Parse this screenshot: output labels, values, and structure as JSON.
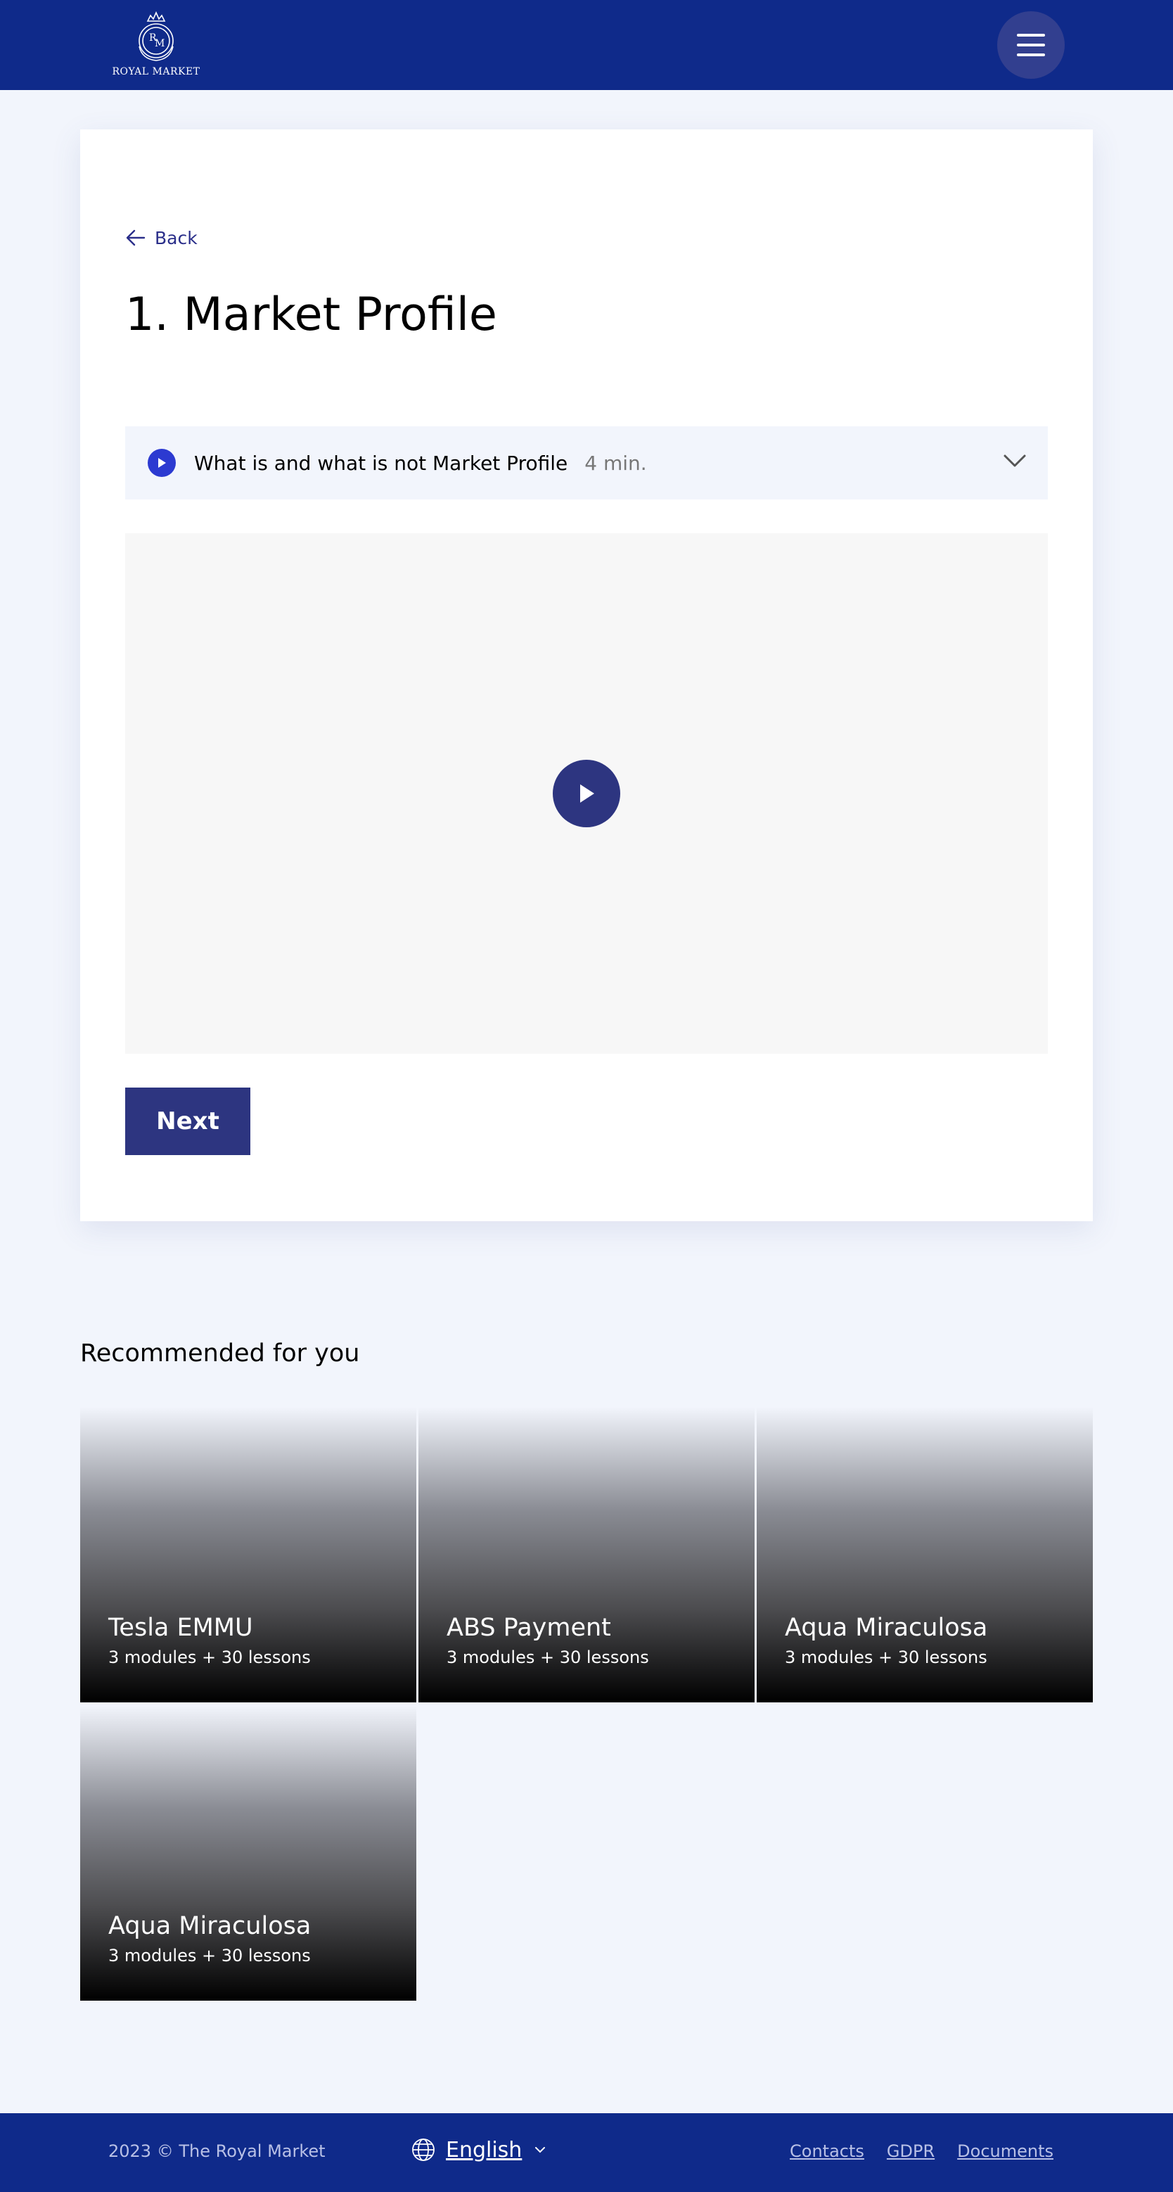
{
  "header": {
    "logo_text": "ROYAL MARKET",
    "menu_icon": "hamburger-menu-icon",
    "colors": {
      "background": "#0f2a8a",
      "menu_button": "#323f8f"
    }
  },
  "lesson_page": {
    "back_label": "Back",
    "title": "1. Market Profile",
    "lesson": {
      "title": "What is and what is not Market Profile",
      "duration": "4 min."
    },
    "next_label": "Next",
    "colors": {
      "accent": "#2d3580",
      "lesson_play": "#2c3ad1"
    }
  },
  "recommended": {
    "heading": "Recommended for you",
    "items": [
      {
        "name": "Tesla EMMU",
        "meta": "3 modules + 30 lessons"
      },
      {
        "name": "ABS Payment",
        "meta": "3 modules + 30 lessons"
      },
      {
        "name": "Aqua Miraculosa",
        "meta": "3 modules + 30 lessons"
      },
      {
        "name": "Aqua Miraculosa",
        "meta": "3 modules + 30 lessons"
      }
    ]
  },
  "footer": {
    "copyright": "2023 © The Royal Market",
    "language": "English",
    "links": [
      "Contacts",
      "GDPR",
      "Documents"
    ]
  }
}
